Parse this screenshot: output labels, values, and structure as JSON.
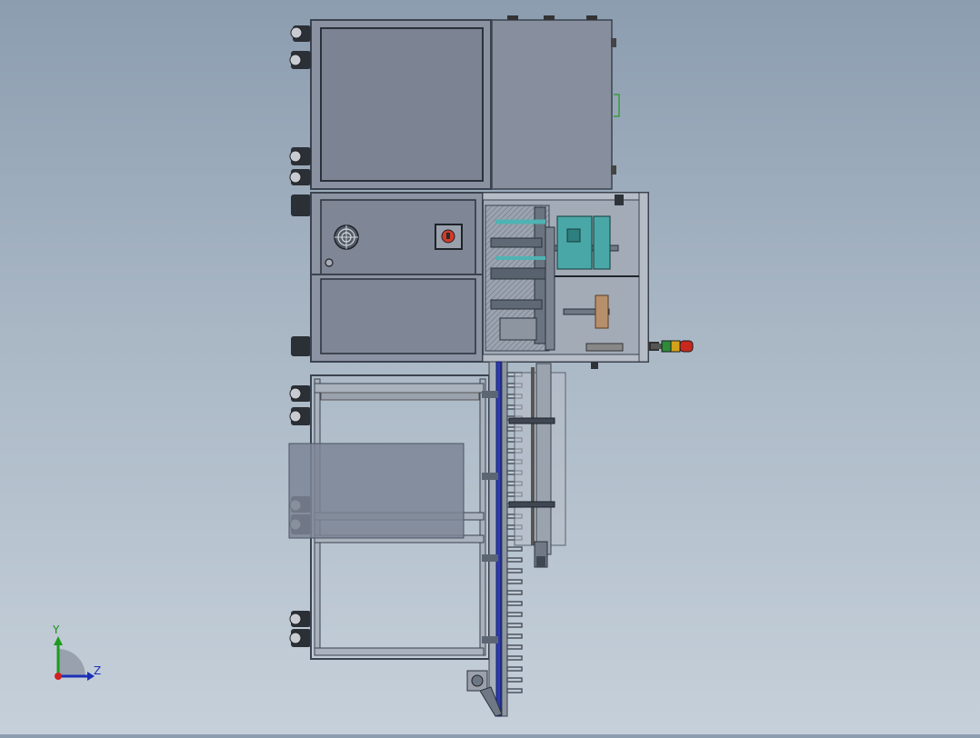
{
  "triad": {
    "y_label": "Y",
    "z_label": "Z",
    "y_color": "#1f9a1f",
    "z_color": "#1b2fb5",
    "x_color": "#d22020"
  },
  "colors": {
    "frame": "#4a5563",
    "panel": "#7e8595",
    "panel_light": "#8c93a2",
    "profile": "#aab2bd",
    "conveyor_blue": "#2b3bb0",
    "teal_block": "#3fb3b3",
    "stop_button": "#d23a2a",
    "tower_green": "#2e8b3a",
    "tower_amber": "#d4a21a",
    "tower_red": "#c8281e"
  },
  "icons": [
    "fan-grille-icon",
    "emergency-stop-icon",
    "signal-tower-icon",
    "caster-wheel-icon",
    "motor-icon"
  ]
}
